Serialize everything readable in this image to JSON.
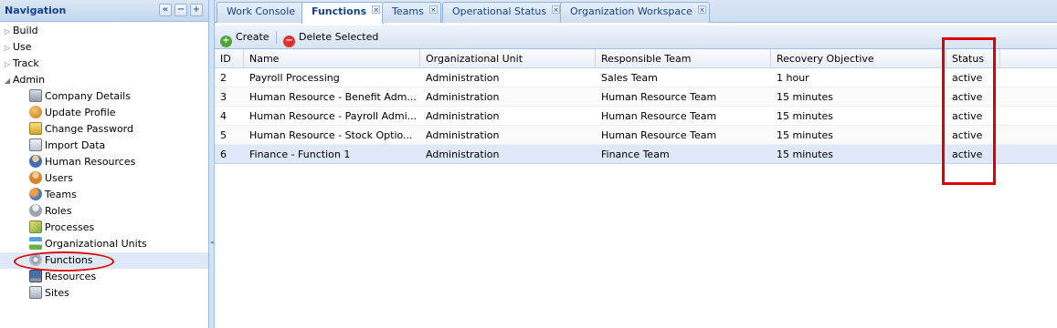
{
  "navigation": {
    "title": "Navigation",
    "tools": [
      "«",
      "−",
      "+"
    ],
    "groups": [
      {
        "label": "Build",
        "expanded": false
      },
      {
        "label": "Use",
        "expanded": false
      },
      {
        "label": "Track",
        "expanded": false
      },
      {
        "label": "Admin",
        "expanded": true
      }
    ],
    "admin_items": [
      {
        "label": "Company Details",
        "icon": "building-icon"
      },
      {
        "label": "Update Profile",
        "icon": "user-edit-icon"
      },
      {
        "label": "Change Password",
        "icon": "key-icon"
      },
      {
        "label": "Import Data",
        "icon": "import-icon"
      },
      {
        "label": "Human Resources",
        "icon": "person-icon"
      },
      {
        "label": "Users",
        "icon": "user-icon"
      },
      {
        "label": "Teams",
        "icon": "team-icon"
      },
      {
        "label": "Roles",
        "icon": "role-icon"
      },
      {
        "label": "Processes",
        "icon": "process-icon"
      },
      {
        "label": "Organizational Units",
        "icon": "org-chart-icon"
      },
      {
        "label": "Functions",
        "icon": "gear-icon"
      },
      {
        "label": "Resources",
        "icon": "monitor-icon"
      },
      {
        "label": "Sites",
        "icon": "site-icon"
      }
    ],
    "selected_item": "Functions"
  },
  "tabs": [
    {
      "label": "Work Console",
      "closable": false
    },
    {
      "label": "Functions",
      "closable": true,
      "active": true
    },
    {
      "label": "Teams",
      "closable": true
    },
    {
      "label": "Operational Status",
      "closable": true
    },
    {
      "label": "Organization Workspace",
      "closable": true
    }
  ],
  "toolbar": {
    "create_label": "Create",
    "delete_label": "Delete Selected"
  },
  "grid": {
    "columns": [
      "ID",
      "Name",
      "Organizational Unit",
      "Responsible Team",
      "Recovery Objective",
      "Status"
    ],
    "rows": [
      [
        "2",
        "Payroll Processing",
        "Administration",
        "Sales Team",
        "1 hour",
        "active"
      ],
      [
        "3",
        "Human Resource - Benefit Adm...",
        "Administration",
        "Human Resource Team",
        "15 minutes",
        "active"
      ],
      [
        "4",
        "Human Resource - Payroll Admi...",
        "Administration",
        "Human Resource Team",
        "15 minutes",
        "active"
      ],
      [
        "5",
        "Human Resource - Stock Optio...",
        "Administration",
        "Human Resource Team",
        "15 minutes",
        "active"
      ],
      [
        "6",
        "Finance - Function 1",
        "Administration",
        "Finance Team",
        "15 minutes",
        "active"
      ]
    ],
    "selected_row_id": "6"
  },
  "colors": {
    "accent_border": "#99bbe8",
    "highlight_red": "#e00000",
    "selection": "#dfe8f6"
  }
}
